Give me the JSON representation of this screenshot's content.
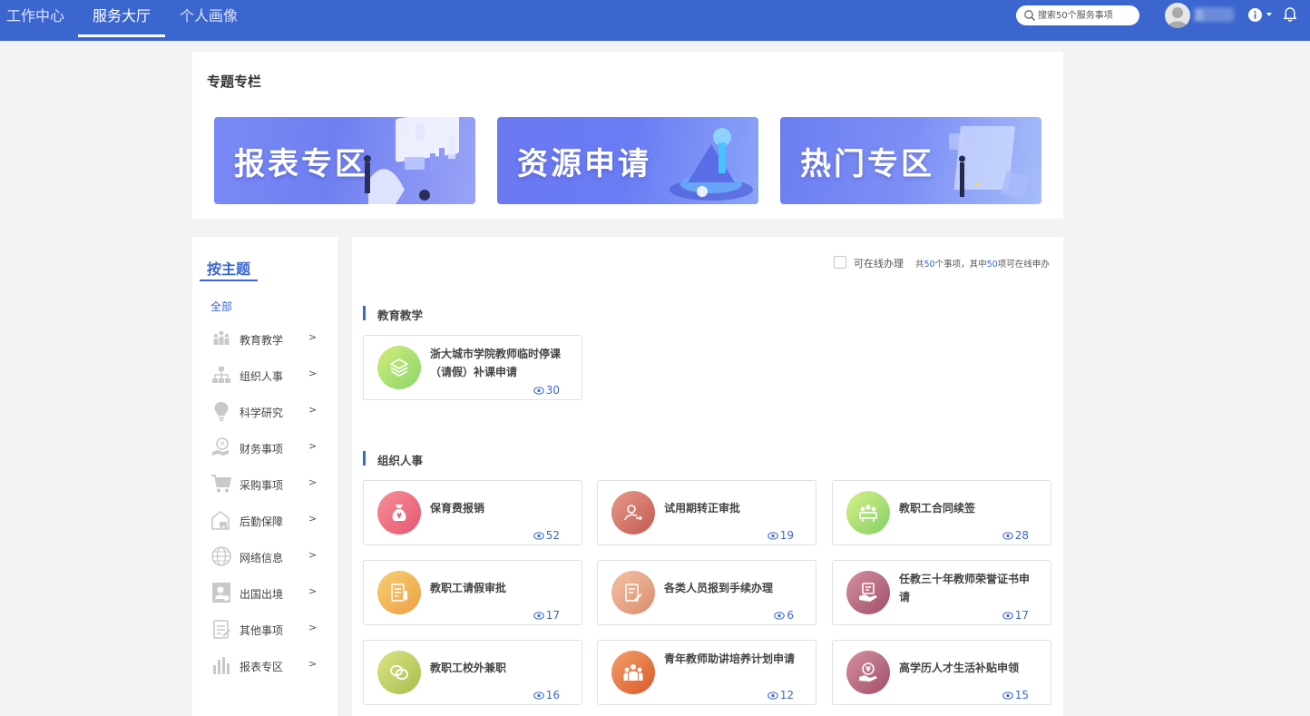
{
  "nav": {
    "tabs": [
      {
        "label": "工作中心"
      },
      {
        "label": "服务大厅",
        "active": true
      },
      {
        "label": "个人画像"
      }
    ],
    "search_placeholder": "搜索50个服务事项",
    "user_name": "王",
    "accent": "#3b66cf"
  },
  "topics": {
    "title": "专题专栏",
    "banners": [
      {
        "label": "报表专区"
      },
      {
        "label": "资源申请"
      },
      {
        "label": "热门专区"
      }
    ]
  },
  "sidebar": {
    "title": "按主题",
    "all_label": "全部",
    "items": [
      {
        "label": "教育教学",
        "icon": "teaching-icon"
      },
      {
        "label": "组织人事",
        "icon": "org-chart-icon"
      },
      {
        "label": "科学研究",
        "icon": "bulb-icon"
      },
      {
        "label": "财务事项",
        "icon": "finance-icon"
      },
      {
        "label": "采购事项",
        "icon": "cart-icon"
      },
      {
        "label": "后勤保障",
        "icon": "logistics-icon"
      },
      {
        "label": "网络信息",
        "icon": "globe-icon"
      },
      {
        "label": "出国出境",
        "icon": "passport-icon"
      },
      {
        "label": "其他事项",
        "icon": "clipboard-icon"
      },
      {
        "label": "报表专区",
        "icon": "bar-chart-icon"
      }
    ],
    "chevron": ">"
  },
  "main": {
    "online_label": "可在线办理",
    "summary_prefix": "共",
    "summary_total": "50",
    "summary_mid": "个事项，其中",
    "summary_online": "50",
    "summary_suffix": "项可在线申办",
    "categories": [
      {
        "title": "教育教学",
        "services": [
          {
            "name": "浙大城市学院教师临时停课（请假）补课申请",
            "views": "30",
            "icon": "layers-icon",
            "color": "#9fd66a"
          }
        ]
      },
      {
        "title": "组织人事",
        "services": [
          {
            "name": "保育费报销",
            "views": "52",
            "icon": "money-bag-icon",
            "color": "#ec6d7e"
          },
          {
            "name": "试用期转正审批",
            "views": "19",
            "icon": "user-transfer-icon",
            "color": "#d9786a"
          },
          {
            "name": "教职工合同续签",
            "views": "28",
            "icon": "meeting-icon",
            "color": "#9fd66a"
          },
          {
            "name": "教职工请假审批",
            "views": "17",
            "icon": "leave-form-icon",
            "color": "#f0b25a"
          },
          {
            "name": "各类人员报到手续办理",
            "views": "6",
            "icon": "form-pen-icon",
            "color": "#e5a58a"
          },
          {
            "name": "任教三十年教师荣誉证书申请",
            "views": "17",
            "icon": "certificate-hand-icon",
            "color": "#c06f83"
          },
          {
            "name": "教职工校外兼职",
            "views": "16",
            "icon": "link-icon",
            "color": "#b6cc66"
          },
          {
            "name": "青年教师助讲培养计划申请",
            "views": "12",
            "icon": "group-icon",
            "color": "#e47a3f"
          },
          {
            "name": "高学历人才生活补贴申领",
            "views": "15",
            "icon": "subsidy-hand-icon",
            "color": "#c06f83"
          }
        ]
      }
    ]
  }
}
